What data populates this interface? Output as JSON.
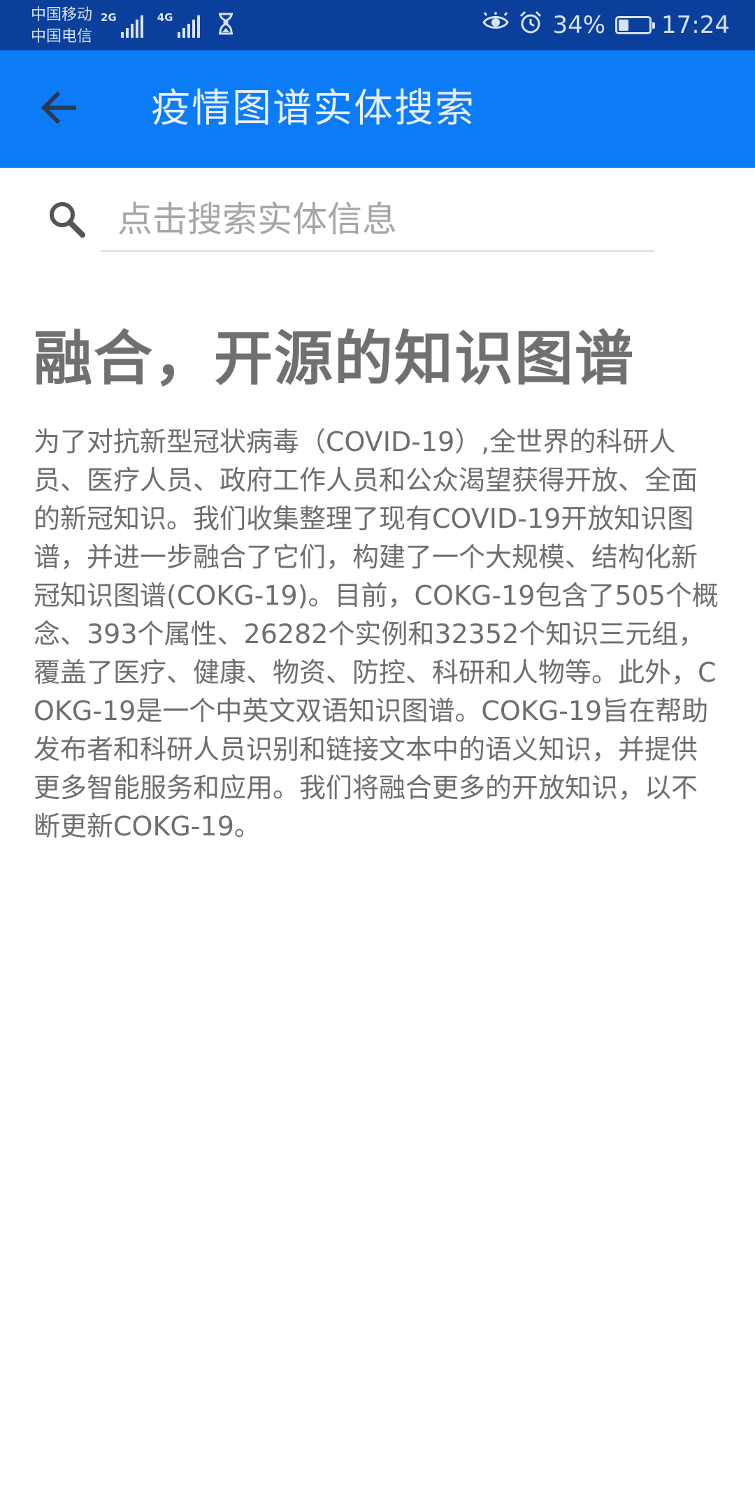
{
  "status_bar": {
    "carrier_1": "中国移动",
    "carrier_2": "中国电信",
    "network_1": "2G",
    "network_2": "4G",
    "battery_percent": "34%",
    "battery_level": 0.34,
    "time": "17:24",
    "icons": [
      "signal-icon",
      "hourglass-icon",
      "eye-icon",
      "alarm-icon",
      "battery-icon"
    ]
  },
  "app_bar": {
    "title": "疫情图谱实体搜索",
    "back_icon": "arrow-left-icon",
    "color": "#0b7cf5"
  },
  "search": {
    "placeholder": "点击搜索实体信息",
    "value": "",
    "icon": "search-icon"
  },
  "content": {
    "headline": "融合，开源的知识图谱",
    "paragraph": "为了对抗新型冠状病毒（COVID-19）,全世界的科研人员、医疗人员、政府工作人员和公众渴望获得开放、全面的新冠知识。我们收集整理了现有COVID-19开放知识图谱，并进一步融合了它们，构建了一个大规模、结构化新冠知识图谱(COKG-19)。目前，COKG-19包含了505个概念、393个属性、26282个实例和32352个知识三元组，覆盖了医疗、健康、物资、防控、科研和人物等。此外，COKG-19是一个中英文双语知识图谱。COKG-19旨在帮助发布者和科研人员识别和链接文本中的语义知识，并提供更多智能服务和应用。我们将融合更多的开放知识，以不断更新COKG-19。"
  },
  "colors": {
    "status_bar": "#0a3f9c",
    "app_bar": "#0b7cf5",
    "headline_text": "#707070",
    "body_text": "#6e6e6e"
  }
}
